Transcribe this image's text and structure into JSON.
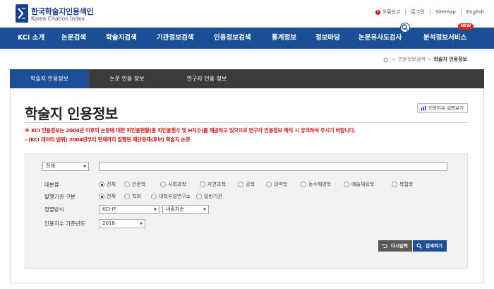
{
  "header": {
    "logo_ko": "한국학술지인용색인",
    "logo_en": "Korea Citation Index",
    "util": [
      "오류신고",
      "로그인",
      "Sitemap",
      "English"
    ],
    "new_badge": "NEW",
    "nav": [
      "KCI 소개",
      "논문검색",
      "학술지검색",
      "기관정보검색",
      "인용정보검색",
      "통계정보",
      "정보마당",
      "논문유사도검사",
      "분석정보서비스"
    ]
  },
  "breadcrumb": [
    "인용정보검색",
    "학술지 인용정보"
  ],
  "subtabs": [
    "학술지 인용정보",
    "논문 인용 정보",
    "연구자 인용 정보"
  ],
  "page": {
    "title": "학술지 인용정보",
    "guide_button": "인용지수 설명보기",
    "notice_1": "※ KCI 인용정보는 2004년 이후의 논문에 대한 피인용현황(총 피인용횟수 및 H지수)를 제공하고 있으므로 연구자 인용정보 해석 시 유의하여 주시기 바랍니다.",
    "notice_2": "- (KCI 데이터 범위) 2004년부터 현재까지 발행된 재단등재(후보) 학술지 논문"
  },
  "search": {
    "field_select": "전체",
    "keyword_value": "",
    "category_label": "대분류",
    "category_options": [
      "전체",
      "인문학",
      "사회과학",
      "자연과학",
      "공학",
      "의약학",
      "농수해양학",
      "예술체육학",
      "복합학"
    ],
    "publisher_label": "발행기관 구분",
    "publisher_options": [
      "전체",
      "학회",
      "대학부설연구소",
      "일반기관"
    ],
    "sort_label": "정렬방식",
    "sort_select": "KCI-IF",
    "order_select": "내림차순",
    "year_label": "인용지수 기준년도",
    "year_select": "2018",
    "reset_button": "다시입력",
    "search_button": "검색하기"
  },
  "colors": {
    "nav_bg": "#1b4f95",
    "tab_bar": "#3b3b3b",
    "notice": "#cc1111"
  }
}
